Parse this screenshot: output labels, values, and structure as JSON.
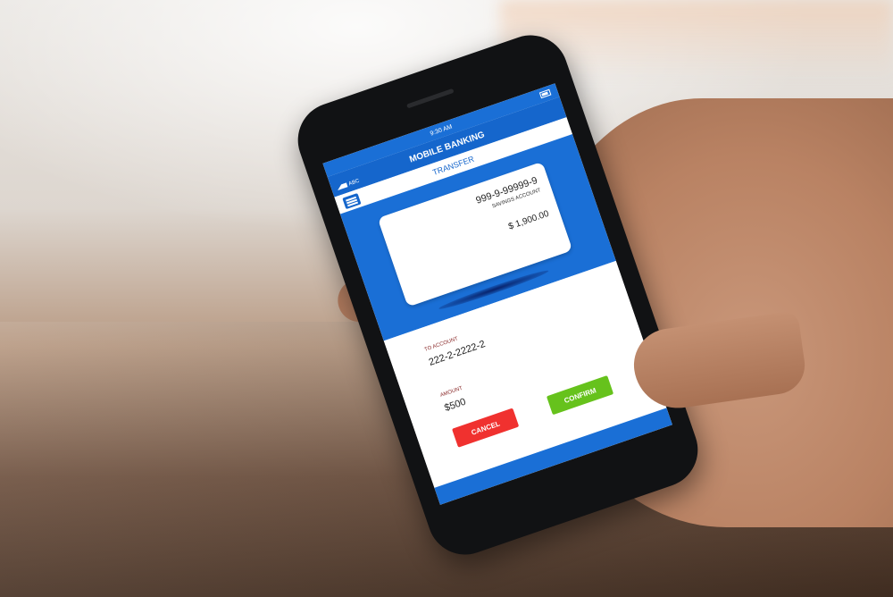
{
  "status_bar": {
    "time": "9:30 AM",
    "carrier": "ABC"
  },
  "app_bar": {
    "title": "MOBILE BANKING"
  },
  "sub_bar": {
    "title": "TRANSFER"
  },
  "from_card": {
    "account_number": "999-9-99999-9",
    "account_type": "SAVINGS ACCOUNT",
    "balance": "$ 1,900.00"
  },
  "form": {
    "to_account_label": "TO ACCOUNT",
    "to_account_value": "222-2-2222-2",
    "amount_label": "AMOUNT",
    "amount_value": "$500"
  },
  "buttons": {
    "cancel": "CANCEL",
    "confirm": "CONFIRM"
  },
  "colors": {
    "primary_blue": "#1566cc",
    "cancel_red": "#f0312f",
    "confirm_green": "#66c21c"
  },
  "icons": {
    "menu": "menu-icon",
    "battery": "battery-icon",
    "signal": "signal-icon"
  }
}
